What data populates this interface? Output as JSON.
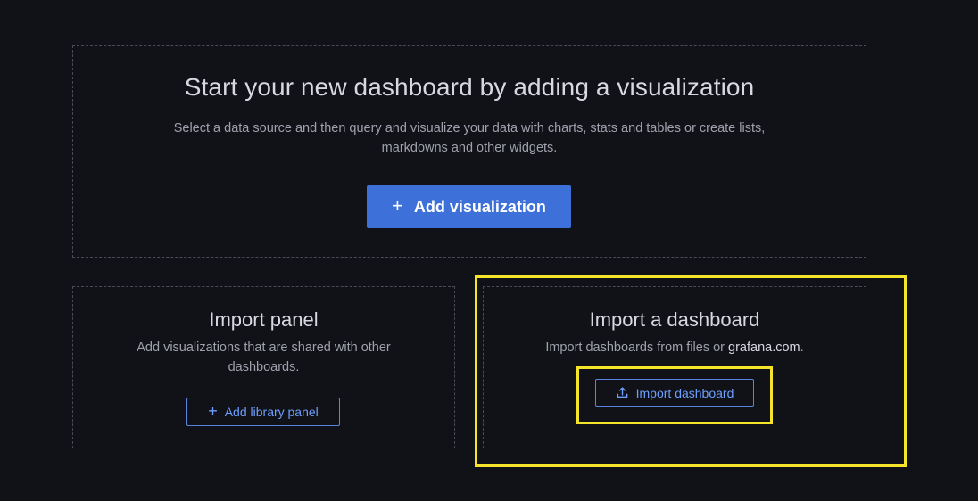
{
  "hero": {
    "title": "Start your new dashboard by adding a visualization",
    "description": "Select a data source and then query and visualize your data with charts, stats and tables or create lists, markdowns and other widgets.",
    "button_icon": "+",
    "button_label": "Add visualization"
  },
  "import_panel": {
    "title": "Import panel",
    "description": "Add visualizations that are shared with other dashboards.",
    "button_icon": "+",
    "button_label": "Add library panel"
  },
  "import_dashboard": {
    "title": "Import a dashboard",
    "description_prefix": "Import dashboards from files or ",
    "description_link": "grafana.com",
    "description_suffix": ".",
    "button_icon": "upload-icon",
    "button_label": "Import dashboard"
  },
  "colors": {
    "background": "#111217",
    "primary": "#3d71d9",
    "link": "#6e9fff",
    "highlight": "#f4e52a"
  }
}
